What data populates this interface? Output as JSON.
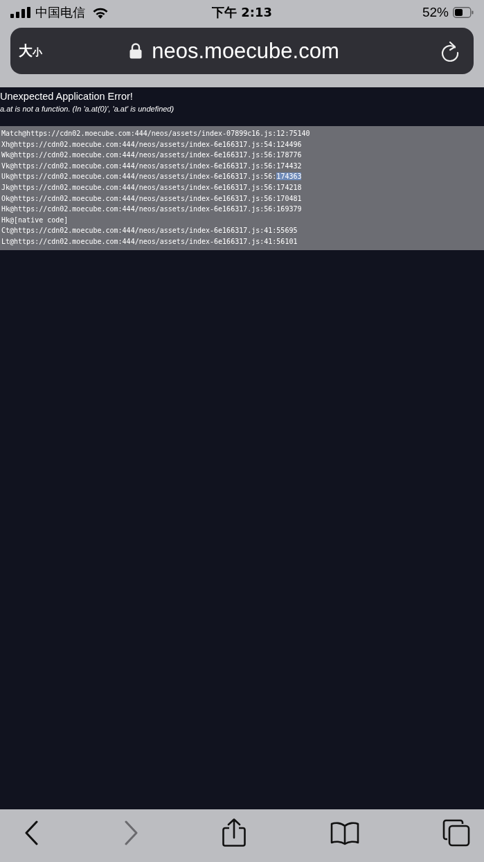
{
  "status_bar": {
    "carrier": "中国电信",
    "time": "下午 2:13",
    "battery": "52%"
  },
  "address_bar": {
    "text_size_button": {
      "big": "大",
      "small": "小"
    },
    "url": "neos.moecube.com"
  },
  "error": {
    "title": "Unexpected Application Error!",
    "message": "a.at is not a function. (In 'a.at(0)', 'a.at' is undefined)",
    "stack": [
      {
        "text": "Match@https://cdn02.moecube.com:444/neos/assets/index-07899c16.js:12:75140"
      },
      {
        "text": "Xh@https://cdn02.moecube.com:444/neos/assets/index-6e166317.js:54:124496"
      },
      {
        "text": "Wk@https://cdn02.moecube.com:444/neos/assets/index-6e166317.js:56:178776"
      },
      {
        "text": "Vk@https://cdn02.moecube.com:444/neos/assets/index-6e166317.js:56:174432"
      },
      {
        "text": "Uk@https://cdn02.moecube.com:444/neos/assets/index-6e166317.js:56:",
        "selected_text": "174363"
      },
      {
        "text": "Jk@https://cdn02.moecube.com:444/neos/assets/index-6e166317.js:56:174218"
      },
      {
        "text": "Ok@https://cdn02.moecube.com:444/neos/assets/index-6e166317.js:56:170481"
      },
      {
        "text": "Hk@https://cdn02.moecube.com:444/neos/assets/index-6e166317.js:56:169379"
      },
      {
        "text": "Hk@[native code]"
      },
      {
        "text": "Ct@https://cdn02.moecube.com:444/neos/assets/index-6e166317.js:41:55695"
      },
      {
        "text": "Lt@https://cdn02.moecube.com:444/neos/assets/index-6e166317.js:41:56101"
      }
    ]
  },
  "toolbar": [
    {
      "kind": "back",
      "disabled": false
    },
    {
      "kind": "forward",
      "disabled": true
    },
    {
      "kind": "share",
      "disabled": false
    },
    {
      "kind": "bookmarks",
      "disabled": false
    },
    {
      "kind": "tabs",
      "disabled": false
    }
  ]
}
